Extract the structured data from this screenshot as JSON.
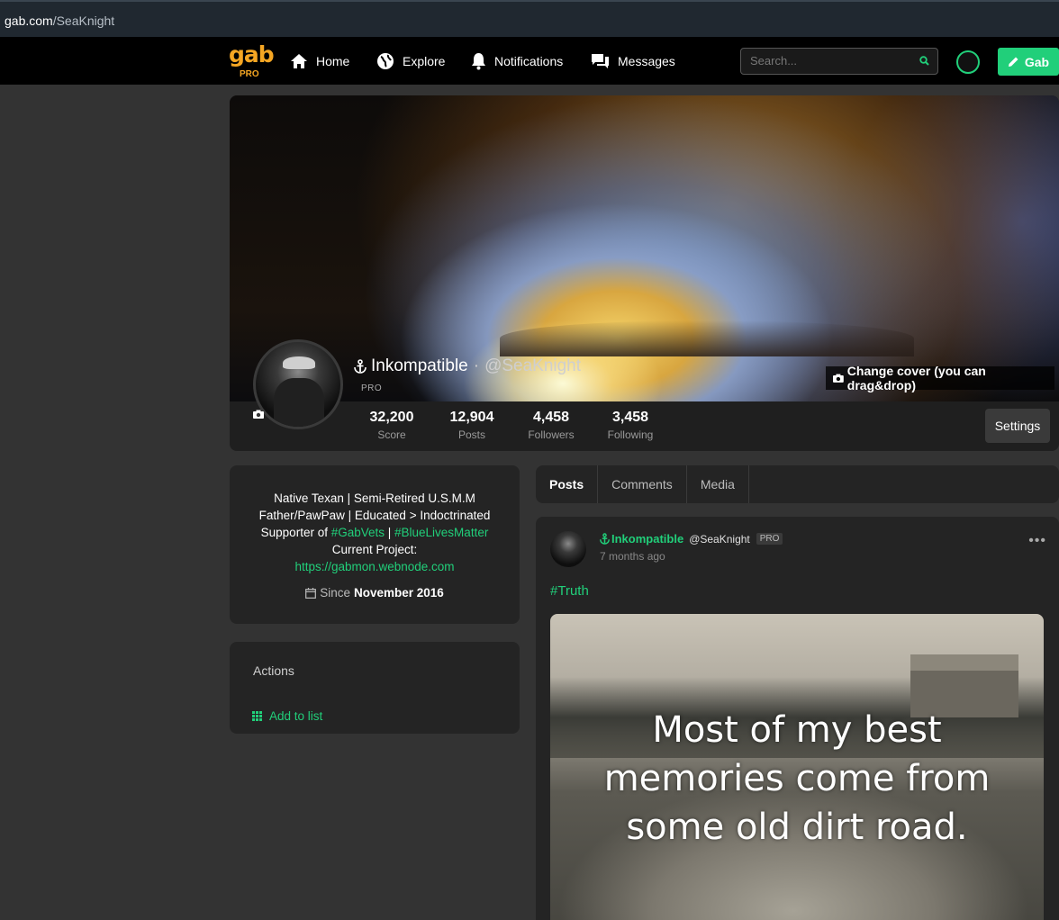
{
  "browser": {
    "url_host": "gab.com",
    "url_path": "/SeaKnight"
  },
  "nav": {
    "logo_text": "gab",
    "logo_badge": "PRO",
    "items": [
      {
        "label": "Home",
        "icon": "home-icon"
      },
      {
        "label": "Explore",
        "icon": "globe-icon"
      },
      {
        "label": "Notifications",
        "icon": "bell-icon"
      },
      {
        "label": "Messages",
        "icon": "chat-icon"
      }
    ],
    "search_placeholder": "Search...",
    "compose_label": "Gab"
  },
  "colors": {
    "accent": "#21cf7a",
    "brand": "#f5a623",
    "background": "#333333",
    "card": "#242424"
  },
  "profile": {
    "display_name": "Inkompatible",
    "separator": "·",
    "handle": "@SeaKnight",
    "badge": "PRO",
    "change_cover_label": "Change cover (you can drag&drop)",
    "settings_label": "Settings",
    "stats": [
      {
        "value": "32,200",
        "label": "Score"
      },
      {
        "value": "12,904",
        "label": "Posts"
      },
      {
        "value": "4,458",
        "label": "Followers"
      },
      {
        "value": "3,458",
        "label": "Following"
      }
    ]
  },
  "bio": {
    "line1": "Native Texan | Semi-Retired U.S.M.M",
    "line2": "Father/PawPaw | Educated > Indoctrinated",
    "line3_prefix": "Supporter of ",
    "tag1": "#GabVets",
    "line3_sep": " | ",
    "tag2": "#BlueLivesMatter",
    "line4": "Current Project:",
    "link": "https://gabmon.webnode.com",
    "since_label": "Since",
    "since_date": "November 2016"
  },
  "actions": {
    "title": "Actions",
    "add_to_list": "Add to list"
  },
  "tabs": [
    "Posts",
    "Comments",
    "Media"
  ],
  "post": {
    "author": "Inkompatible",
    "handle": "@SeaKnight",
    "badge": "PRO",
    "time": "7 months ago",
    "more": "•••",
    "hashtag": "#Truth",
    "image_text_line1": "Most of my best",
    "image_text_line2": "memories come from",
    "image_text_line3": "some old dirt road."
  }
}
